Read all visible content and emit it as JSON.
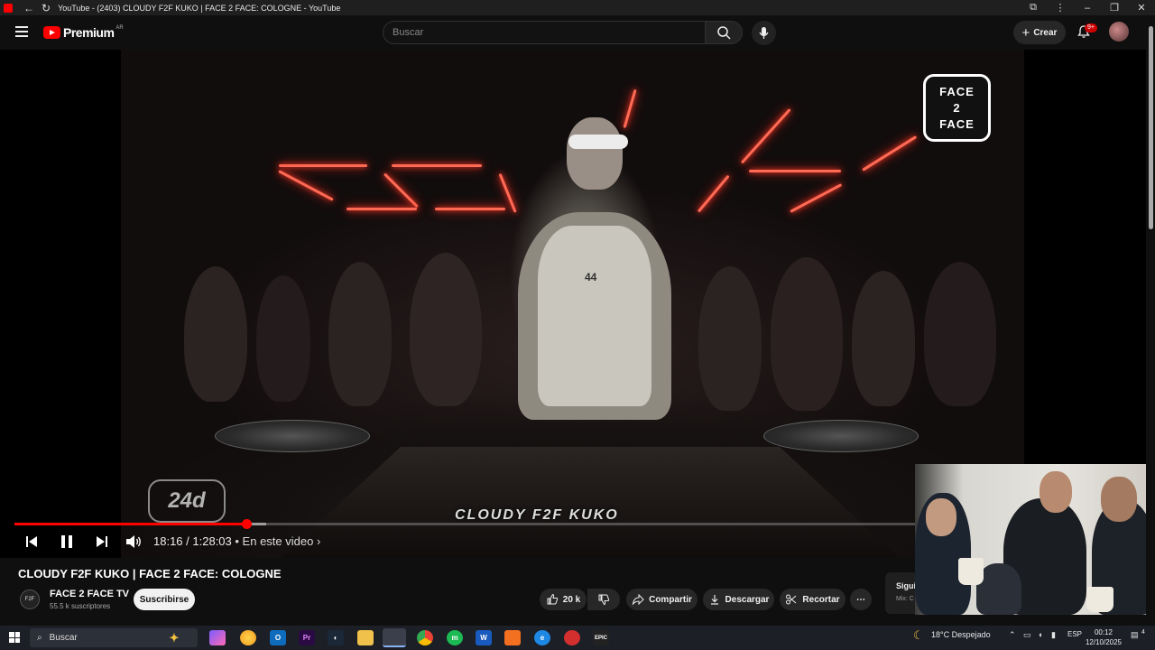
{
  "window": {
    "title": "YouTube - (2403) CLOUDY F2F KUKO | FACE 2 FACE: COLOGNE - YouTube"
  },
  "header": {
    "logo_text": "Premium",
    "country_code": "AR",
    "search_placeholder": "Buscar",
    "create_label": "Crear",
    "notif_badge": "9+"
  },
  "video": {
    "overlay_logo_lines": [
      "FACE",
      "2",
      "FACE"
    ],
    "watermark": "24d",
    "caption_text": "CLOUDY F2F KUKO",
    "current_time": "18:16",
    "duration": "1:28:03",
    "time_sep": " / ",
    "chapters_label": "• En este video ›",
    "progress_fraction": 0.207,
    "buffered_fraction": 0.225
  },
  "info": {
    "title": "CLOUDY F2F KUKO | FACE 2 FACE: COLOGNE",
    "channel_name": "FACE 2 FACE TV",
    "channel_avatar_text": "F2F",
    "subscribers": "55.5 k suscriptores",
    "subscribe_label": "Suscribirse",
    "likes": "20 k",
    "share_label": "Compartir",
    "download_label": "Descargar",
    "clip_label": "Recortar",
    "side_card_title": "Sigui",
    "side_card_sub": "Mix: C"
  },
  "taskbar": {
    "search_label": "Buscar",
    "weather": "18°C  Despejado",
    "lang": "ESP",
    "time": "00:12",
    "date": "12/10/2025",
    "notif_count": "4"
  },
  "colors": {
    "accent": "#ff0000",
    "background": "#0f0f0f",
    "beam": "#ff6a55"
  }
}
